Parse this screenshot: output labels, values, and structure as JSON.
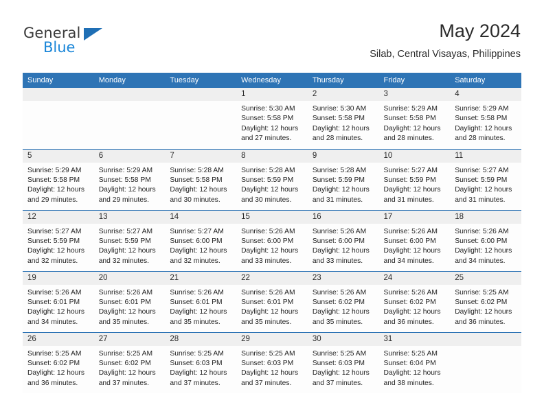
{
  "brand": {
    "name_part1": "General",
    "name_part2": "Blue",
    "triangle_color": "#1f6fb5",
    "blue_text_color": "#1a86d8"
  },
  "header": {
    "month_title": "May 2024",
    "location": "Silab, Central Visayas, Philippines"
  },
  "theme": {
    "header_band": "#2e74b5",
    "daynum_band": "#efefef",
    "row_divider": "#2e74b5",
    "text": "#222222"
  },
  "weekdays": [
    "Sunday",
    "Monday",
    "Tuesday",
    "Wednesday",
    "Thursday",
    "Friday",
    "Saturday"
  ],
  "labels": {
    "sunrise_prefix": "Sunrise:",
    "sunset_prefix": "Sunset:",
    "daylight_prefix": "Daylight:"
  },
  "weeks": [
    [
      {
        "day": "",
        "empty": true,
        "sunrise": "",
        "sunset": "",
        "daylight_line1": "",
        "daylight_line2": ""
      },
      {
        "day": "",
        "empty": true,
        "sunrise": "",
        "sunset": "",
        "daylight_line1": "",
        "daylight_line2": ""
      },
      {
        "day": "",
        "empty": true,
        "sunrise": "",
        "sunset": "",
        "daylight_line1": "",
        "daylight_line2": ""
      },
      {
        "day": "1",
        "empty": false,
        "sunrise": "Sunrise: 5:30 AM",
        "sunset": "Sunset: 5:58 PM",
        "daylight_line1": "Daylight: 12 hours",
        "daylight_line2": "and 27 minutes."
      },
      {
        "day": "2",
        "empty": false,
        "sunrise": "Sunrise: 5:30 AM",
        "sunset": "Sunset: 5:58 PM",
        "daylight_line1": "Daylight: 12 hours",
        "daylight_line2": "and 28 minutes."
      },
      {
        "day": "3",
        "empty": false,
        "sunrise": "Sunrise: 5:29 AM",
        "sunset": "Sunset: 5:58 PM",
        "daylight_line1": "Daylight: 12 hours",
        "daylight_line2": "and 28 minutes."
      },
      {
        "day": "4",
        "empty": false,
        "sunrise": "Sunrise: 5:29 AM",
        "sunset": "Sunset: 5:58 PM",
        "daylight_line1": "Daylight: 12 hours",
        "daylight_line2": "and 28 minutes."
      }
    ],
    [
      {
        "day": "5",
        "empty": false,
        "sunrise": "Sunrise: 5:29 AM",
        "sunset": "Sunset: 5:58 PM",
        "daylight_line1": "Daylight: 12 hours",
        "daylight_line2": "and 29 minutes."
      },
      {
        "day": "6",
        "empty": false,
        "sunrise": "Sunrise: 5:29 AM",
        "sunset": "Sunset: 5:58 PM",
        "daylight_line1": "Daylight: 12 hours",
        "daylight_line2": "and 29 minutes."
      },
      {
        "day": "7",
        "empty": false,
        "sunrise": "Sunrise: 5:28 AM",
        "sunset": "Sunset: 5:58 PM",
        "daylight_line1": "Daylight: 12 hours",
        "daylight_line2": "and 30 minutes."
      },
      {
        "day": "8",
        "empty": false,
        "sunrise": "Sunrise: 5:28 AM",
        "sunset": "Sunset: 5:59 PM",
        "daylight_line1": "Daylight: 12 hours",
        "daylight_line2": "and 30 minutes."
      },
      {
        "day": "9",
        "empty": false,
        "sunrise": "Sunrise: 5:28 AM",
        "sunset": "Sunset: 5:59 PM",
        "daylight_line1": "Daylight: 12 hours",
        "daylight_line2": "and 31 minutes."
      },
      {
        "day": "10",
        "empty": false,
        "sunrise": "Sunrise: 5:27 AM",
        "sunset": "Sunset: 5:59 PM",
        "daylight_line1": "Daylight: 12 hours",
        "daylight_line2": "and 31 minutes."
      },
      {
        "day": "11",
        "empty": false,
        "sunrise": "Sunrise: 5:27 AM",
        "sunset": "Sunset: 5:59 PM",
        "daylight_line1": "Daylight: 12 hours",
        "daylight_line2": "and 31 minutes."
      }
    ],
    [
      {
        "day": "12",
        "empty": false,
        "sunrise": "Sunrise: 5:27 AM",
        "sunset": "Sunset: 5:59 PM",
        "daylight_line1": "Daylight: 12 hours",
        "daylight_line2": "and 32 minutes."
      },
      {
        "day": "13",
        "empty": false,
        "sunrise": "Sunrise: 5:27 AM",
        "sunset": "Sunset: 5:59 PM",
        "daylight_line1": "Daylight: 12 hours",
        "daylight_line2": "and 32 minutes."
      },
      {
        "day": "14",
        "empty": false,
        "sunrise": "Sunrise: 5:27 AM",
        "sunset": "Sunset: 6:00 PM",
        "daylight_line1": "Daylight: 12 hours",
        "daylight_line2": "and 32 minutes."
      },
      {
        "day": "15",
        "empty": false,
        "sunrise": "Sunrise: 5:26 AM",
        "sunset": "Sunset: 6:00 PM",
        "daylight_line1": "Daylight: 12 hours",
        "daylight_line2": "and 33 minutes."
      },
      {
        "day": "16",
        "empty": false,
        "sunrise": "Sunrise: 5:26 AM",
        "sunset": "Sunset: 6:00 PM",
        "daylight_line1": "Daylight: 12 hours",
        "daylight_line2": "and 33 minutes."
      },
      {
        "day": "17",
        "empty": false,
        "sunrise": "Sunrise: 5:26 AM",
        "sunset": "Sunset: 6:00 PM",
        "daylight_line1": "Daylight: 12 hours",
        "daylight_line2": "and 34 minutes."
      },
      {
        "day": "18",
        "empty": false,
        "sunrise": "Sunrise: 5:26 AM",
        "sunset": "Sunset: 6:00 PM",
        "daylight_line1": "Daylight: 12 hours",
        "daylight_line2": "and 34 minutes."
      }
    ],
    [
      {
        "day": "19",
        "empty": false,
        "sunrise": "Sunrise: 5:26 AM",
        "sunset": "Sunset: 6:01 PM",
        "daylight_line1": "Daylight: 12 hours",
        "daylight_line2": "and 34 minutes."
      },
      {
        "day": "20",
        "empty": false,
        "sunrise": "Sunrise: 5:26 AM",
        "sunset": "Sunset: 6:01 PM",
        "daylight_line1": "Daylight: 12 hours",
        "daylight_line2": "and 35 minutes."
      },
      {
        "day": "21",
        "empty": false,
        "sunrise": "Sunrise: 5:26 AM",
        "sunset": "Sunset: 6:01 PM",
        "daylight_line1": "Daylight: 12 hours",
        "daylight_line2": "and 35 minutes."
      },
      {
        "day": "22",
        "empty": false,
        "sunrise": "Sunrise: 5:26 AM",
        "sunset": "Sunset: 6:01 PM",
        "daylight_line1": "Daylight: 12 hours",
        "daylight_line2": "and 35 minutes."
      },
      {
        "day": "23",
        "empty": false,
        "sunrise": "Sunrise: 5:26 AM",
        "sunset": "Sunset: 6:02 PM",
        "daylight_line1": "Daylight: 12 hours",
        "daylight_line2": "and 35 minutes."
      },
      {
        "day": "24",
        "empty": false,
        "sunrise": "Sunrise: 5:26 AM",
        "sunset": "Sunset: 6:02 PM",
        "daylight_line1": "Daylight: 12 hours",
        "daylight_line2": "and 36 minutes."
      },
      {
        "day": "25",
        "empty": false,
        "sunrise": "Sunrise: 5:25 AM",
        "sunset": "Sunset: 6:02 PM",
        "daylight_line1": "Daylight: 12 hours",
        "daylight_line2": "and 36 minutes."
      }
    ],
    [
      {
        "day": "26",
        "empty": false,
        "sunrise": "Sunrise: 5:25 AM",
        "sunset": "Sunset: 6:02 PM",
        "daylight_line1": "Daylight: 12 hours",
        "daylight_line2": "and 36 minutes."
      },
      {
        "day": "27",
        "empty": false,
        "sunrise": "Sunrise: 5:25 AM",
        "sunset": "Sunset: 6:02 PM",
        "daylight_line1": "Daylight: 12 hours",
        "daylight_line2": "and 37 minutes."
      },
      {
        "day": "28",
        "empty": false,
        "sunrise": "Sunrise: 5:25 AM",
        "sunset": "Sunset: 6:03 PM",
        "daylight_line1": "Daylight: 12 hours",
        "daylight_line2": "and 37 minutes."
      },
      {
        "day": "29",
        "empty": false,
        "sunrise": "Sunrise: 5:25 AM",
        "sunset": "Sunset: 6:03 PM",
        "daylight_line1": "Daylight: 12 hours",
        "daylight_line2": "and 37 minutes."
      },
      {
        "day": "30",
        "empty": false,
        "sunrise": "Sunrise: 5:25 AM",
        "sunset": "Sunset: 6:03 PM",
        "daylight_line1": "Daylight: 12 hours",
        "daylight_line2": "and 37 minutes."
      },
      {
        "day": "31",
        "empty": false,
        "sunrise": "Sunrise: 5:25 AM",
        "sunset": "Sunset: 6:04 PM",
        "daylight_line1": "Daylight: 12 hours",
        "daylight_line2": "and 38 minutes."
      },
      {
        "day": "",
        "empty": true,
        "sunrise": "",
        "sunset": "",
        "daylight_line1": "",
        "daylight_line2": ""
      }
    ]
  ]
}
